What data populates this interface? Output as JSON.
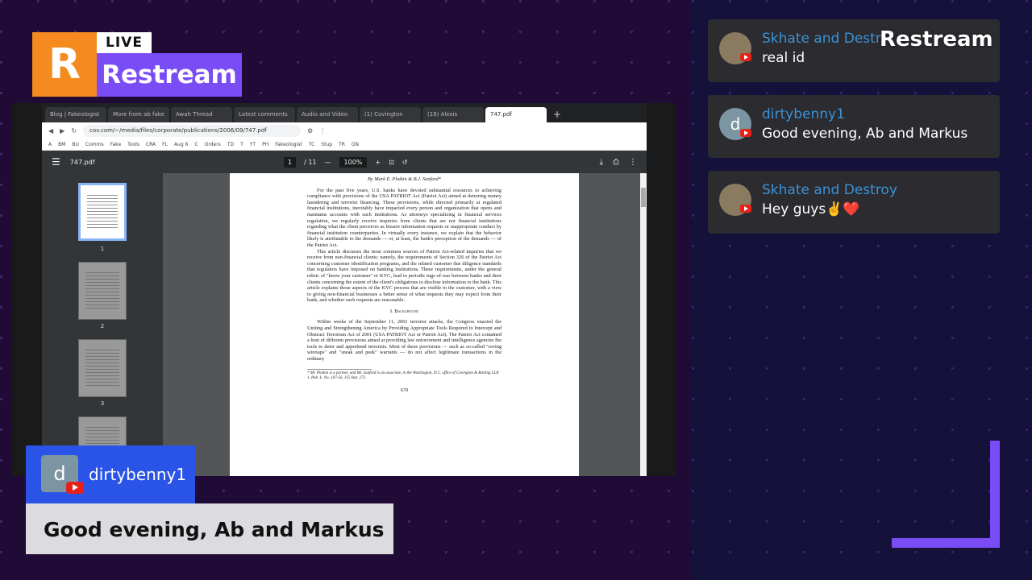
{
  "brand": {
    "logo_letter": "R",
    "live_label": "LIVE",
    "name": "Restream",
    "watermark": "Restream",
    "orange": "#f58a1f",
    "purple": "#7a4cf5"
  },
  "browser": {
    "tabs": [
      "Blog | Fakeologist",
      "More from ab fake",
      "Awah Thread",
      "Latest comments",
      "Audio and Video",
      "(1) Covington",
      "(19) Alexis",
      "747.pdf"
    ],
    "url": "cov.com/~/media/files/corporate/publications/2006/09/747.pdf",
    "bookmarks": [
      "A",
      "BM",
      "BU",
      "Comms",
      "Fake",
      "Tools",
      "CRA",
      "FL",
      "Aug 6",
      "C",
      "Orders",
      "TD",
      "T",
      "YT",
      "PH",
      "Fakeologist",
      "TC",
      "Stup",
      "TR",
      "GN"
    ]
  },
  "pdf": {
    "filename": "747.pdf",
    "page_current": "1",
    "page_total": "/ 11",
    "zoom": "100%",
    "thumbnail_numbers": [
      "1",
      "2",
      "3"
    ],
    "authors": "By Mark E. Plotkin & B.J. Sanford*",
    "para1": "For the past five years, U.S. banks have devoted substantial resources to achieving compliance with provisions of the USA PATRIOT Act (Patriot Act) aimed at deterring money laundering and terrorist financing. These provisions, while directed primarily at regulated financial institutions, inevitably have impacted every person and organization that opens and maintains accounts with such institutions. As attorneys specializing in financial services regulation, we regularly receive inquiries from clients that are not financial institutions regarding what the client perceives as bizarre information requests or inappropriate conduct by financial institution counterparties. In virtually every instance, we explain that the behavior likely is attributable to the demands — or, at least, the bank's perception of the demands — of the Patriot Act.",
    "para2": "This article discusses the most common sources of Patriot Act-related inquiries that we receive from non-financial clients: namely, the requirements of Section 326 of the Patriot Act concerning customer identification programs, and the related customer due diligence standards that regulators have imposed on banking institutions. These requirements, under the general rubric of \"know your customer\" or KYC, lead to periodic tugs-of-war between banks and their clients concerning the extent of the client's obligations to disclose information to the bank. This article explains those aspects of the KYC process that are visible to the customer, with a view to giving non-financial businesses a better sense of what requests they may expect from their bank, and whether such requests are reasonable.",
    "heading": "I. Background",
    "para3": "Within weeks of the September 11, 2001 terrorist attacks, the Congress enacted the Uniting and Strengthening America by Providing Appropriate Tools Required to Intercept and Obstruct Terrorism Act of 2001 (USA PATRIOT Act or Patriot Act). The Patriot Act contained a host of different provisions aimed at providing law enforcement and intelligence agencies the tools to deter and apprehend terrorists. Most of these provisions — such as so-called \"roving wiretaps\" and \"sneak and peek\" warrants — do not affect legitimate transactions in the ordinary",
    "footnote1": "* Mr. Plotkin is a partner, and Mr. Sanford is an associate, in the Washington, D.C. office of Covington & Burling LLP.",
    "footnote2": "1. Pub. L. No. 107-56, 115 Stat. 272.",
    "page_number": "670"
  },
  "chat": [
    {
      "name": "Skhate and Destroy",
      "message": "real id",
      "avatar": "photo"
    },
    {
      "name": "dirtybenny1",
      "message": "Good evening, Ab and Markus",
      "avatar": "d"
    },
    {
      "name": "Skhate and Destroy",
      "message": "Hey guys✌️",
      "heart": "❤️",
      "avatar": "photo"
    }
  ],
  "featured": {
    "avatar_letter": "d",
    "name": "dirtybenny1",
    "message": "Good evening, Ab and Markus",
    "header_color": "#2a54e8"
  }
}
